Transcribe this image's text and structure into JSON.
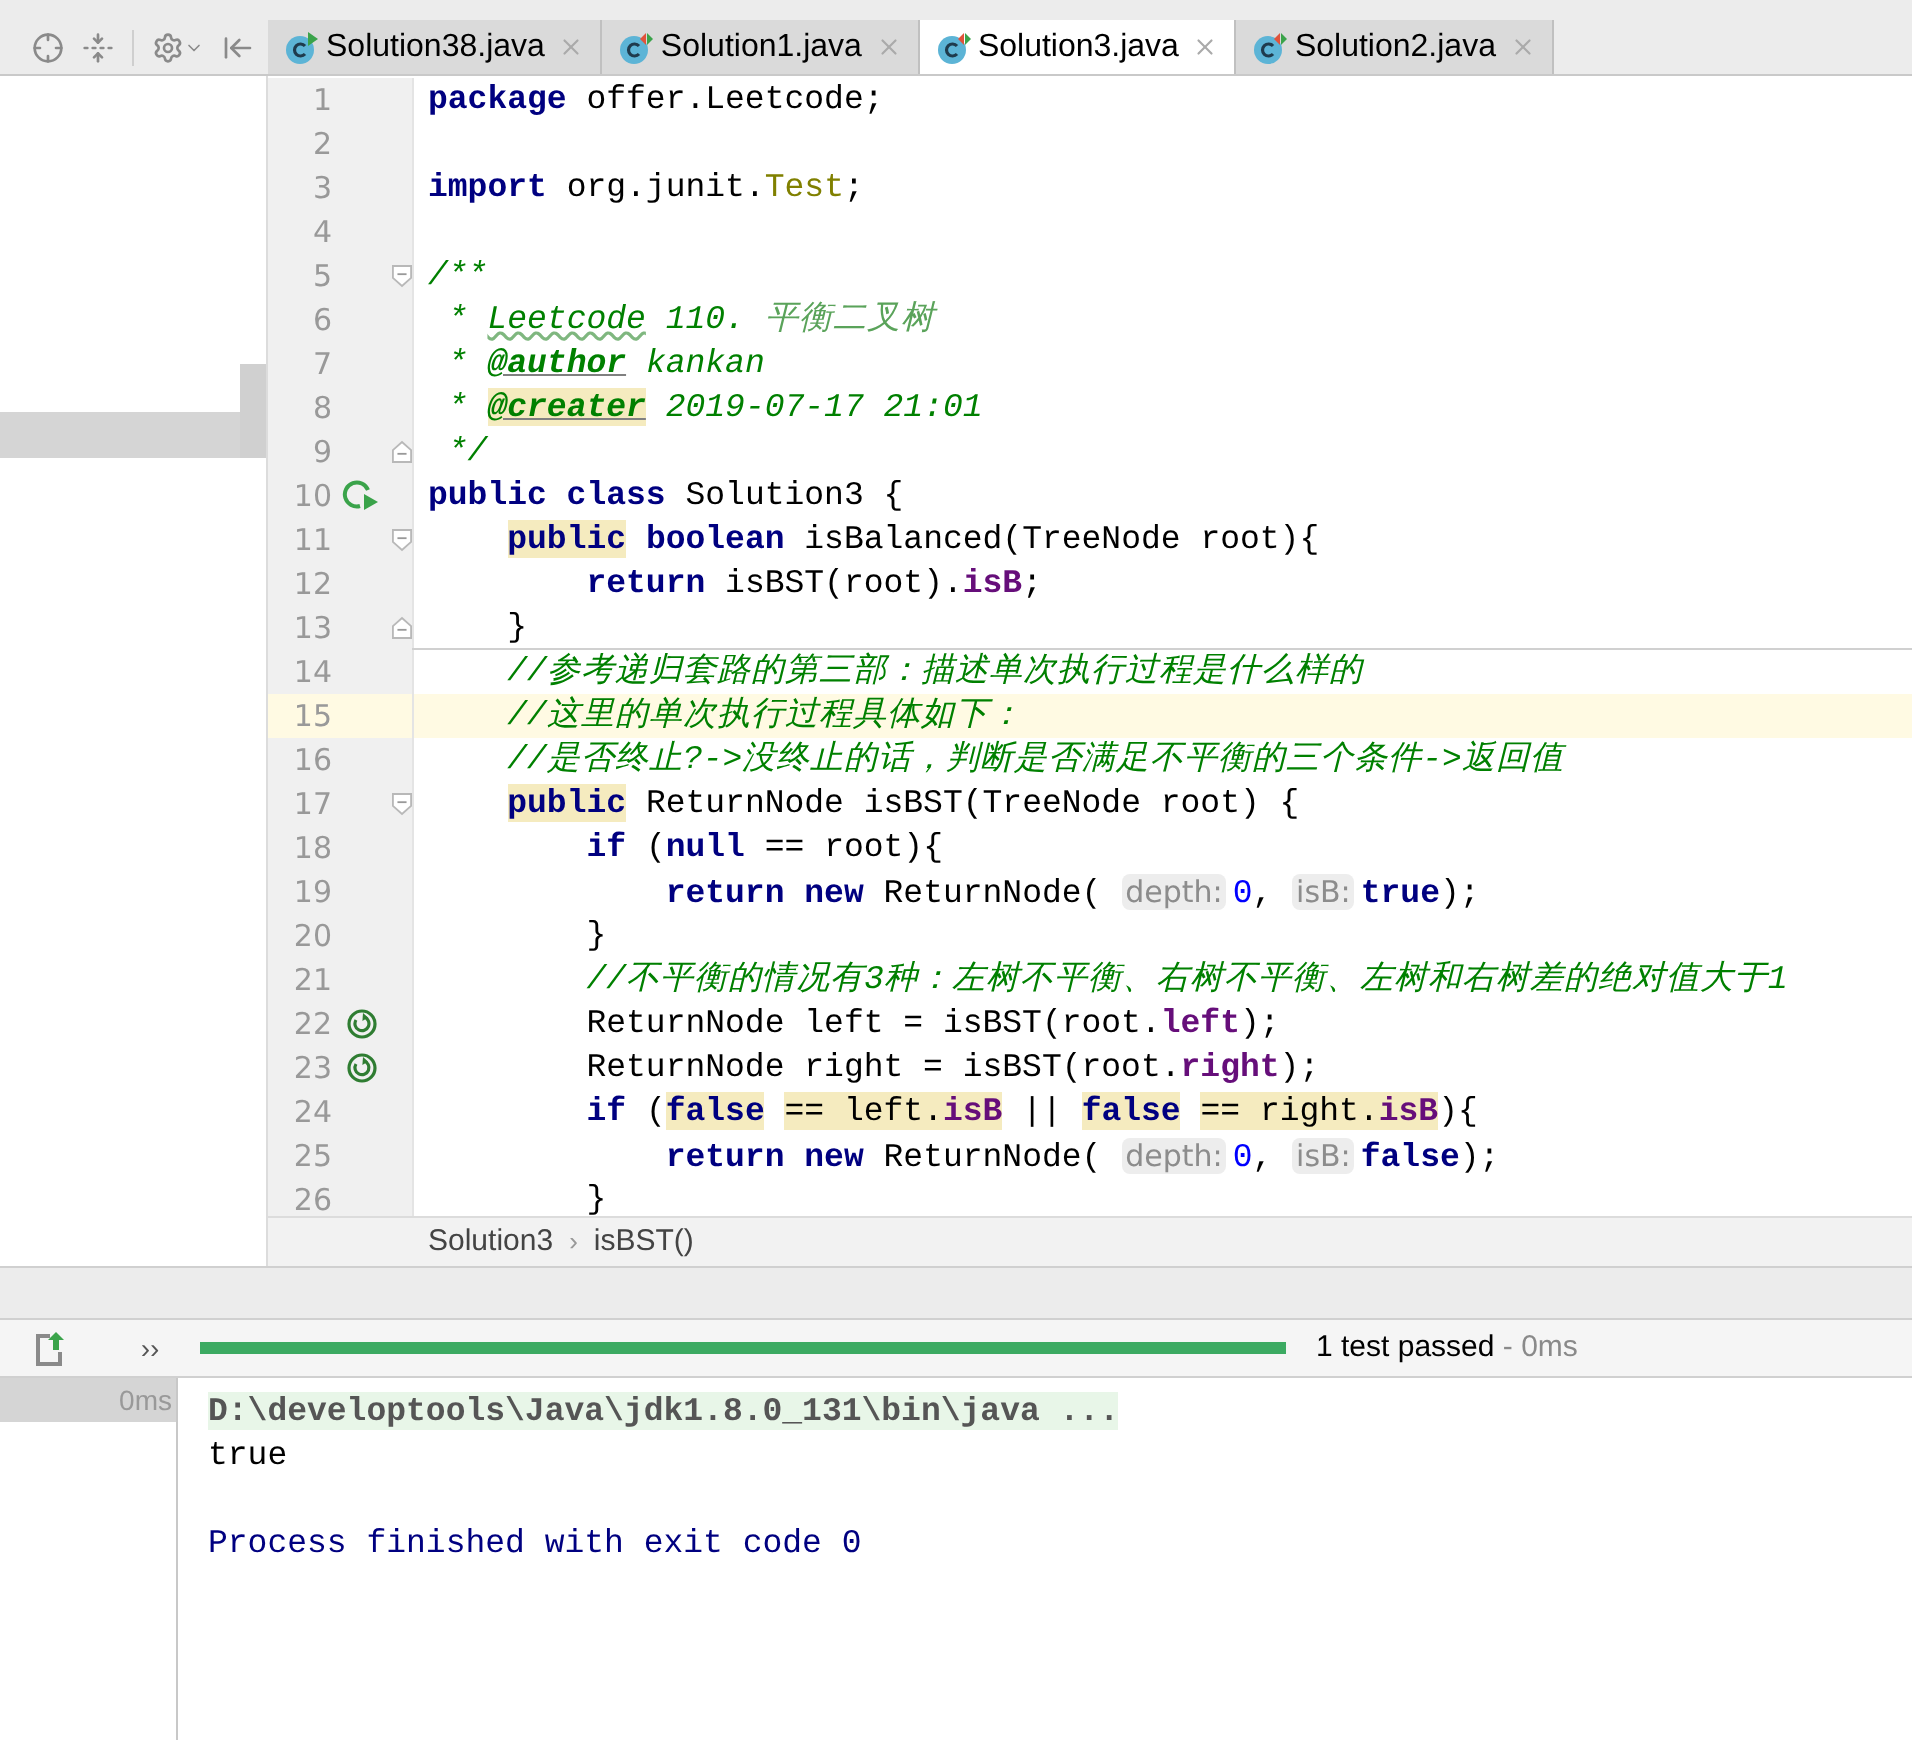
{
  "tabs": [
    {
      "label": "Solution38.java",
      "selected": false,
      "kind": "run"
    },
    {
      "label": "Solution1.java",
      "selected": false,
      "kind": "both"
    },
    {
      "label": "Solution3.java",
      "selected": true,
      "kind": "both"
    },
    {
      "label": "Solution2.java",
      "selected": false,
      "kind": "both"
    }
  ],
  "editor": {
    "lines": [
      {
        "number": "1",
        "current": false,
        "tokens": [
          {
            "kind": "kw",
            "text": "package"
          },
          {
            "kind": "plain",
            "text": " offer.Leetcode;"
          }
        ]
      },
      {
        "number": "2",
        "current": false
      },
      {
        "number": "3",
        "current": false,
        "tokens": [
          {
            "kind": "kw",
            "text": "import"
          },
          {
            "kind": "plain",
            "text": " org.junit."
          },
          {
            "kind": "unused",
            "text": "Test"
          },
          {
            "kind": "plain",
            "text": ";"
          }
        ]
      },
      {
        "number": "4",
        "current": false
      },
      {
        "number": "5",
        "current": false,
        "fold": {
          "kind": "start"
        },
        "tokens": [
          {
            "kind": "doc",
            "text": "/**"
          }
        ]
      },
      {
        "number": "6",
        "current": false,
        "tokens": [
          {
            "kind": "doc",
            "text": " * "
          },
          {
            "kind": "doc_typo",
            "text": "Leetcode"
          },
          {
            "kind": "doc",
            "text": " 110. "
          },
          {
            "kind": "doc_cjk",
            "text": "平衡二叉树"
          }
        ]
      },
      {
        "number": "7",
        "current": false,
        "tokens": [
          {
            "kind": "doc",
            "text": " * "
          },
          {
            "kind": "doctag",
            "text": "@author"
          },
          {
            "kind": "doc",
            "text": " kankan"
          }
        ]
      },
      {
        "number": "8",
        "current": false,
        "tokens": [
          {
            "kind": "doc",
            "text": " * "
          },
          {
            "kind": "doctag_mark",
            "text": "@creater"
          },
          {
            "kind": "doc",
            "text": " 2019-07-17 21:01"
          }
        ]
      },
      {
        "number": "9",
        "current": false,
        "fold": {
          "kind": "end"
        },
        "tokens": [
          {
            "kind": "doc",
            "text": " */"
          }
        ]
      },
      {
        "number": "10",
        "current": false,
        "gutter": {
          "kind": "run"
        },
        "tokens": [
          {
            "kind": "kw",
            "text": "public class"
          },
          {
            "kind": "plain",
            "text": " Solution3 {"
          }
        ]
      },
      {
        "number": "11",
        "current": false,
        "fold": {
          "kind": "start"
        },
        "tokens": [
          {
            "kind": "kw_mark",
            "text": "    public"
          },
          {
            "kind": "kw",
            "text": " boolean"
          },
          {
            "kind": "plain",
            "text": " isBalanced(TreeNode root){"
          }
        ]
      },
      {
        "number": "12",
        "current": false,
        "tokens": [
          {
            "kind": "kw",
            "text": "        return"
          },
          {
            "kind": "plain",
            "text": " isBST(root)."
          },
          {
            "kind": "field",
            "text": "isB"
          },
          {
            "kind": "plain",
            "text": ";"
          }
        ]
      },
      {
        "number": "13",
        "current": false,
        "fold": {
          "kind": "end"
        },
        "separator": true,
        "tokens": [
          {
            "kind": "plain",
            "text": "    }"
          }
        ]
      },
      {
        "number": "14",
        "current": false,
        "tokens": [
          {
            "kind": "comment",
            "text": "    //参考递归套路的第三部：描述单次执行过程是什么样的"
          }
        ]
      },
      {
        "number": "15",
        "current": true,
        "tokens": [
          {
            "kind": "comment",
            "text": "    //这里的单次执行过程具体如下："
          }
        ]
      },
      {
        "number": "16",
        "current": false,
        "tokens": [
          {
            "kind": "comment",
            "text": "    //是否终止?->没终止的话，判断是否满足不平衡的三个条件->返回值"
          }
        ]
      },
      {
        "number": "17",
        "current": false,
        "fold": {
          "kind": "start"
        },
        "tokens": [
          {
            "kind": "kw_mark",
            "text": "    public"
          },
          {
            "kind": "plain",
            "text": " ReturnNode isBST(TreeNode root) {"
          }
        ]
      },
      {
        "number": "18",
        "current": false,
        "tokens": [
          {
            "kind": "kw",
            "text": "        if"
          },
          {
            "kind": "plain",
            "text": " ("
          },
          {
            "kind": "kw",
            "text": "null"
          },
          {
            "kind": "plain",
            "text": " == root){"
          }
        ]
      },
      {
        "number": "19",
        "current": false,
        "tokens": [
          {
            "kind": "kw",
            "text": "            return new"
          },
          {
            "kind": "plain",
            "text": " ReturnNode( "
          },
          {
            "kind": "hint",
            "text": "depth:"
          },
          {
            "kind": "num",
            "text": "0"
          },
          {
            "kind": "plain",
            "text": ", "
          },
          {
            "kind": "hint",
            "text": "isB:"
          },
          {
            "kind": "kw",
            "text": "true"
          },
          {
            "kind": "plain",
            "text": ");"
          }
        ]
      },
      {
        "number": "20",
        "current": false,
        "tokens": [
          {
            "kind": "plain",
            "text": "        }"
          }
        ]
      },
      {
        "number": "21",
        "current": false,
        "tokens": [
          {
            "kind": "comment",
            "text": "        //不平衡的情况有3种：左树不平衡、右树不平衡、左树和右树差的绝对值大于1"
          }
        ]
      },
      {
        "number": "22",
        "current": false,
        "gutter": {
          "kind": "recursion"
        },
        "tokens": [
          {
            "kind": "plain",
            "text": "        ReturnNode left = isBST(root."
          },
          {
            "kind": "field",
            "text": "left"
          },
          {
            "kind": "plain",
            "text": ");"
          }
        ]
      },
      {
        "number": "23",
        "current": false,
        "gutter": {
          "kind": "recursion"
        },
        "tokens": [
          {
            "kind": "plain",
            "text": "        ReturnNode right = isBST(root."
          },
          {
            "kind": "field",
            "text": "right"
          },
          {
            "kind": "plain",
            "text": ");"
          }
        ]
      },
      {
        "number": "24",
        "current": false,
        "tokens": [
          {
            "kind": "kw",
            "text": "        if"
          },
          {
            "kind": "plain",
            "text": " ("
          },
          {
            "kind": "kw_mark",
            "text": "false"
          },
          {
            "kind": "plain_mark",
            "text": " == left."
          },
          {
            "kind": "field_mark",
            "text": "isB"
          },
          {
            "kind": "plain",
            "text": " || "
          },
          {
            "kind": "kw_mark",
            "text": "false"
          },
          {
            "kind": "plain_mark",
            "text": " == right."
          },
          {
            "kind": "field_mark",
            "text": "isB"
          },
          {
            "kind": "plain",
            "text": "){"
          }
        ]
      },
      {
        "number": "25",
        "current": false,
        "tokens": [
          {
            "kind": "kw",
            "text": "            return new"
          },
          {
            "kind": "plain",
            "text": " ReturnNode( "
          },
          {
            "kind": "hint",
            "text": "depth:"
          },
          {
            "kind": "num",
            "text": "0"
          },
          {
            "kind": "plain",
            "text": ", "
          },
          {
            "kind": "hint",
            "text": "isB:"
          },
          {
            "kind": "kw",
            "text": "false"
          },
          {
            "kind": "plain",
            "text": ");"
          }
        ]
      },
      {
        "number": "26",
        "current": false,
        "tokens": [
          {
            "kind": "plain",
            "text": "        }"
          }
        ]
      }
    ],
    "breadcrumbs": {
      "items": [
        "Solution3",
        "isBST()"
      ],
      "separator": "›"
    }
  },
  "run": {
    "more": "››",
    "progress": {
      "level": 1
    },
    "status": "1 test passed",
    "duration": " - 0ms",
    "tests": [
      {
        "label": "0ms",
        "selected": true
      }
    ],
    "console": [
      {
        "kind": "command",
        "text": "D:\\developtools\\Java\\jdk1.8.0_131\\bin\\java ..."
      },
      {
        "kind": "output",
        "text": "true"
      },
      {
        "kind": "blank"
      },
      {
        "kind": "system",
        "text": "Process finished with exit code 0"
      }
    ]
  }
}
